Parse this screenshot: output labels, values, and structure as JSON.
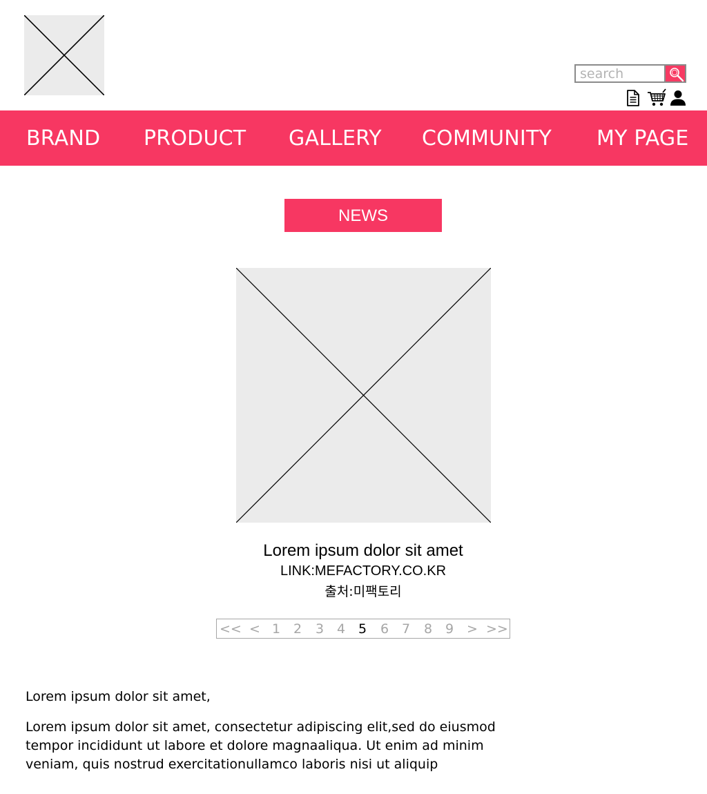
{
  "header": {
    "logo_icon": "image-placeholder-icon",
    "search": {
      "placeholder": "search",
      "value": "",
      "button_icon": "magnifier-icon"
    },
    "utility_icons": [
      "document-icon",
      "cart-icon",
      "user-icon"
    ]
  },
  "nav": {
    "items": [
      {
        "label": "BRAND"
      },
      {
        "label": "PRODUCT"
      },
      {
        "label": "GALLERY"
      },
      {
        "label": "COMMUNITY"
      },
      {
        "label": "MY PAGE"
      }
    ]
  },
  "section": {
    "tab_label": "NEWS"
  },
  "article": {
    "image_icon": "image-placeholder-icon",
    "title": "Lorem ipsum dolor sit amet",
    "link": "LINK:MEFACTORY.CO.KR",
    "source": "출처:미팩토리"
  },
  "pagination": {
    "first": "<<",
    "prev": "<",
    "pages": [
      "1",
      "2",
      "3",
      "4",
      "5",
      "6",
      "7",
      "8",
      "9"
    ],
    "current": "5",
    "next": ">",
    "last": ">>"
  },
  "body": {
    "lead": "Lorem ipsum dolor sit amet,",
    "paragraph": "Lorem ipsum dolor sit amet, consectetur adipiscing elit,sed do eiusmod tempor incididunt ut labore et dolore magnaaliqua. Ut enim ad minim veniam, quis nostrud exercitationullamco laboris nisi ut aliquip"
  },
  "colors": {
    "accent": "#f73762",
    "placeholder_bg": "#ebebeb",
    "muted_text": "#a6a6a6"
  }
}
